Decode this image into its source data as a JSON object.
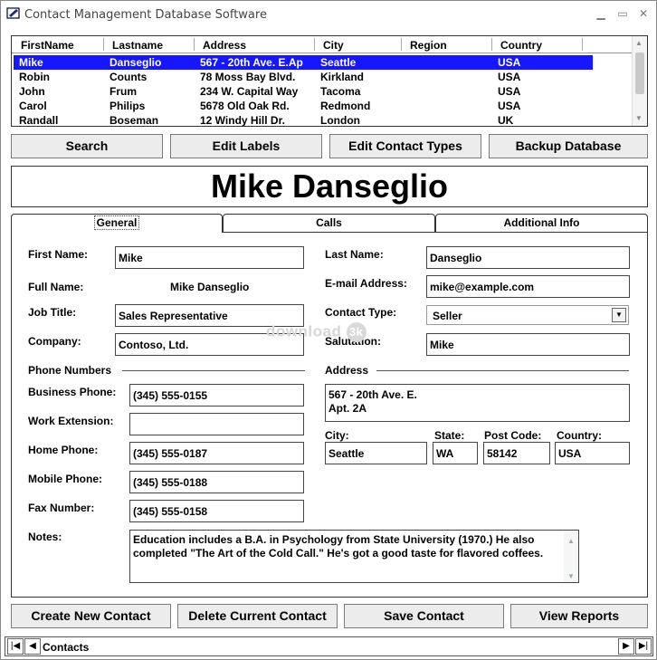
{
  "window": {
    "title": "Contact Management Database Software",
    "minimize": "▭",
    "maximize": "▢",
    "close": "✕"
  },
  "grid": {
    "columns": [
      "FirstName",
      "Lastname",
      "Address",
      "City",
      "Region",
      "Country"
    ],
    "rows": [
      [
        "Mike",
        "Danseglio",
        "567 - 20th Ave. E.Ap",
        "Seattle",
        "",
        "USA"
      ],
      [
        "Robin",
        "Counts",
        "78 Moss Bay Blvd.",
        "Kirkland",
        "",
        "USA"
      ],
      [
        "John",
        "Frum",
        "234 W. Capital Way",
        "Tacoma",
        "",
        "USA"
      ],
      [
        "Carol",
        "Philips",
        "5678 Old Oak Rd.",
        "Redmond",
        "",
        "USA"
      ],
      [
        "Randall",
        "Boseman",
        "12 Windy Hill Dr.",
        "London",
        "",
        "UK"
      ]
    ],
    "selected_row": 0,
    "selection_color": "#1616ff",
    "scroll_up": "▲",
    "scroll_down": "▼"
  },
  "toolbar": {
    "search": "Search",
    "edit_labels": "Edit Labels",
    "edit_contact_types": "Edit Contact Types",
    "backup_database": "Backup Database"
  },
  "contact_name": "Mike Danseglio",
  "tabs": [
    "General",
    "Calls",
    "Additional Info"
  ],
  "active_tab": "General",
  "form": {
    "first_name_label": "First Name:",
    "first_name": "Mike",
    "last_name_label": "Last Name:",
    "last_name": "Danseglio",
    "full_name_label": "Full Name:",
    "full_name": "Mike Danseglio",
    "email_label": "E-mail Address:",
    "email": "mike@example.com",
    "job_title_label": "Job Title:",
    "job_title": "Sales Representative",
    "contact_type_label": "Contact Type:",
    "contact_type": "Seller",
    "company_label": "Company:",
    "company": "Contoso, Ltd.",
    "salutation_label": "Salutation:",
    "salutation": "Mike",
    "phone_section": "Phone Numbers",
    "address_section": "Address",
    "business_phone_label": "Business Phone:",
    "business_phone": "(345) 555-0155",
    "work_ext_label": "Work Extension:",
    "work_ext": "",
    "home_phone_label": "Home Phone:",
    "home_phone": "(345) 555-0187",
    "mobile_phone_label": "Mobile Phone:",
    "mobile_phone": "(345) 555-0188",
    "fax_label": "Fax Number:",
    "fax": "(345) 555-0158",
    "address_line1": "567 - 20th Ave. E.",
    "address_line2": "Apt. 2A",
    "city_label": "City:",
    "city": "Seattle",
    "state_label": "State:",
    "state": "WA",
    "post_code_label": "Post Code:",
    "post_code": "58142",
    "country_label": "Country:",
    "country": "USA",
    "notes_label": "Notes:",
    "notes": "Education includes a B.A. in Psychology from State University (1970.)  He also completed \"The Art of the Cold Call.\"  He's got a good taste for flavored coffees."
  },
  "watermark": {
    "text": "download",
    "badge": "3k"
  },
  "bottom_buttons": {
    "create": "Create New Contact",
    "delete": "Delete Current Contact",
    "save": "Save Contact",
    "reports": "View Reports"
  },
  "navbar": {
    "label": "Contacts",
    "first": "⏮",
    "prev": "◀",
    "next": "▶",
    "last": "⏭"
  }
}
